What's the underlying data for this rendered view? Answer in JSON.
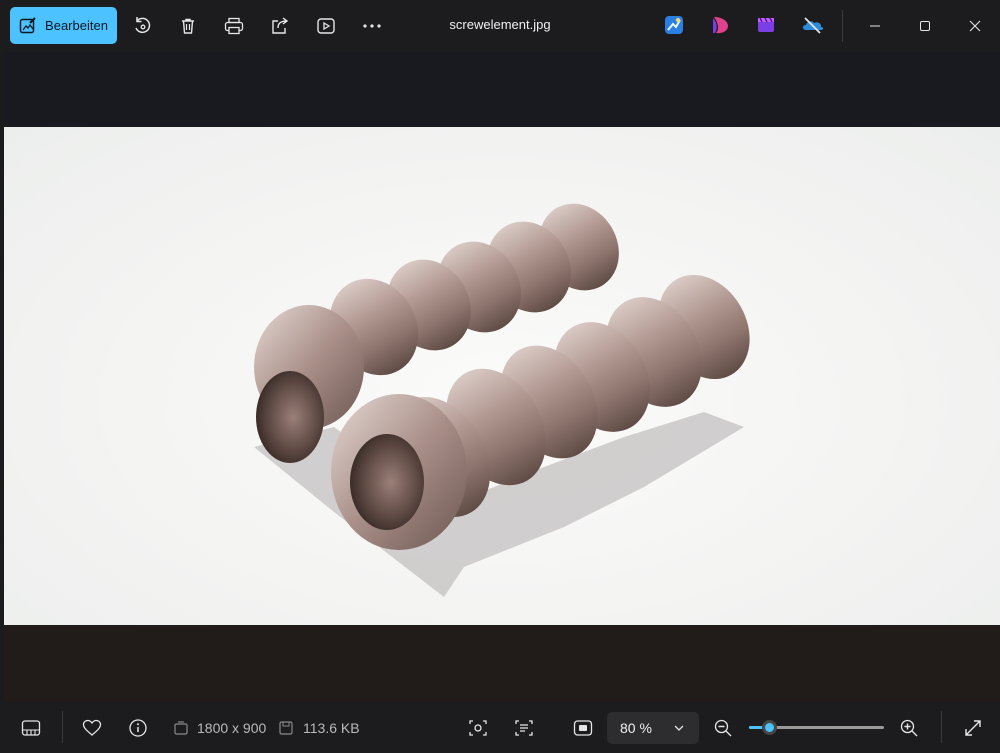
{
  "toolbar": {
    "edit_label": "Bearbeiten",
    "icons": [
      "rotate-icon",
      "delete-icon",
      "print-icon",
      "share-icon",
      "slideshow-icon",
      "more-icon"
    ]
  },
  "window": {
    "title": "screwelement.jpg"
  },
  "app_icons": [
    "designer-icon",
    "clipchamp-icon",
    "video-editor-icon",
    "onedrive-icon"
  ],
  "photo": {
    "description_color": "#a58b85"
  },
  "statusbar": {
    "dimensions": "1800 x 900",
    "file_size": "113.6 KB",
    "zoom_value": "80 %",
    "zoom_slider_fraction": 0.15
  },
  "colors": {
    "accent": "#4cc2ff",
    "background": "#1c1c1e"
  }
}
